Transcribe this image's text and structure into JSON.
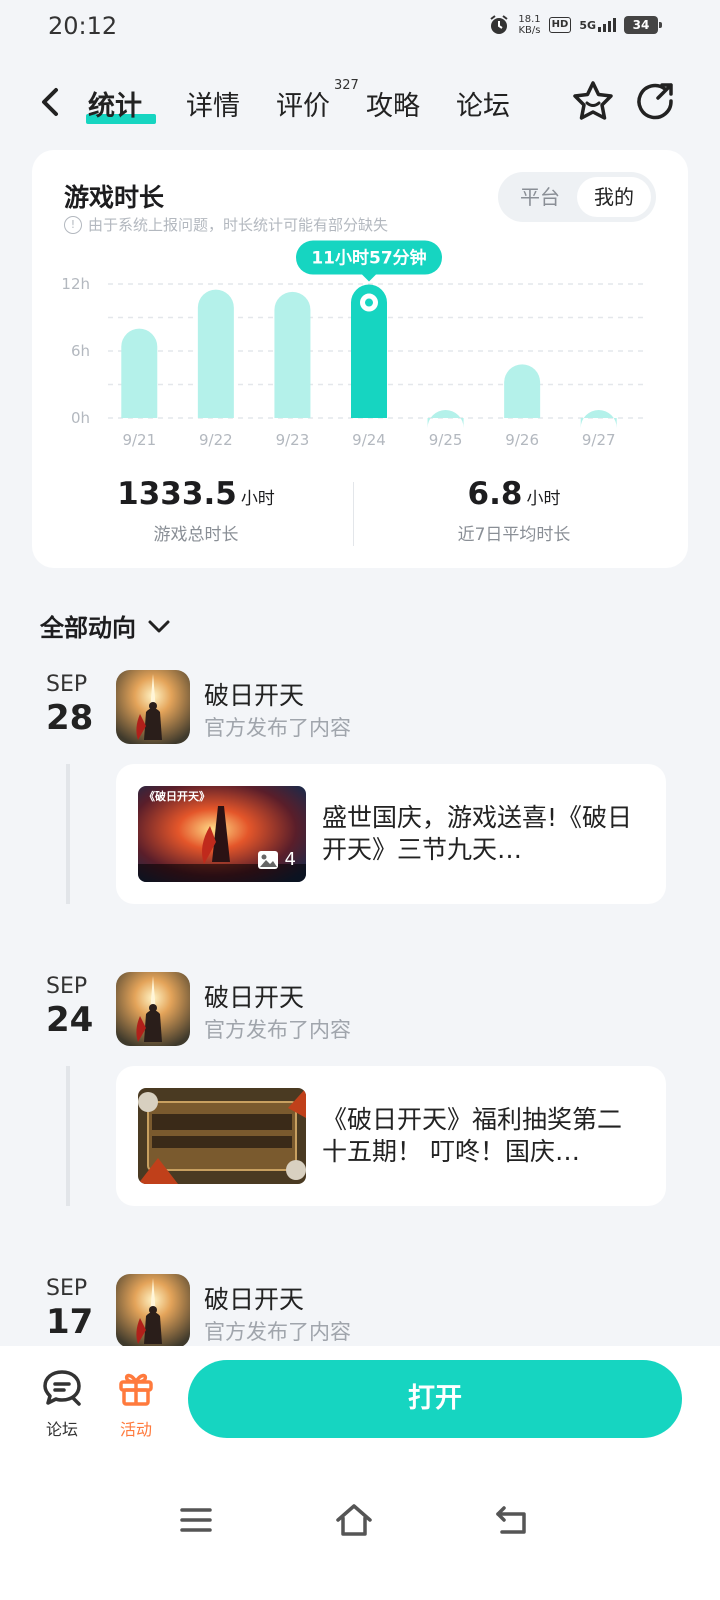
{
  "status_bar": {
    "time": "20:12",
    "speed_value": "18.1",
    "speed_unit": "KB/s",
    "hd": "HD",
    "network": "5G",
    "battery": "34"
  },
  "nav": {
    "tabs": [
      {
        "label": "统计",
        "active": true
      },
      {
        "label": "详情"
      },
      {
        "label": "评价"
      },
      {
        "label": "攻略"
      },
      {
        "label": "论坛"
      }
    ],
    "review_count": "327"
  },
  "stats_card": {
    "title": "游戏时长",
    "note": "由于系统上报问题，时长统计可能有部分缺失",
    "segment": [
      "平台",
      "我的"
    ],
    "segment_selected": "我的",
    "tooltip": "11小时57分钟",
    "total_value": "1333.5",
    "total_unit": "小时",
    "total_label": "游戏总时长",
    "avg_value": "6.8",
    "avg_unit": "小时",
    "avg_label": "近7日平均时长"
  },
  "chart_data": {
    "type": "bar",
    "categories": [
      "9/21",
      "9/22",
      "9/23",
      "9/24",
      "9/25",
      "9/26",
      "9/27"
    ],
    "values": [
      8,
      11.5,
      11.3,
      11.95,
      0.4,
      4.8,
      0.4
    ],
    "y_ticks": [
      "12h",
      "6h",
      "0h"
    ],
    "ylim": [
      0,
      12
    ],
    "highlight_index": 3,
    "color_bar": "#b4f1ea",
    "color_highlight": "#16d5c1",
    "grid": true
  },
  "feed": {
    "filter_label": "全部动向",
    "items": [
      {
        "month": "SEP",
        "day": "28",
        "name": "破日开天",
        "sub": "官方发布了内容",
        "post_text": "盛世国庆，游戏送喜!《破日开天》三节九天…",
        "image_count": "4"
      },
      {
        "month": "SEP",
        "day": "24",
        "name": "破日开天",
        "sub": "官方发布了内容",
        "post_text": "《破日开天》福利抽奖第二十五期！ 叮咚！国庆…"
      },
      {
        "month": "SEP",
        "day": "17",
        "name": "破日开天",
        "sub": "官方发布了内容"
      }
    ]
  },
  "bottom_bar": {
    "forum_label": "论坛",
    "activity_label": "活动",
    "open_label": "打开",
    "accent": "#16d5c1",
    "activity_color": "#ff7a3d"
  }
}
